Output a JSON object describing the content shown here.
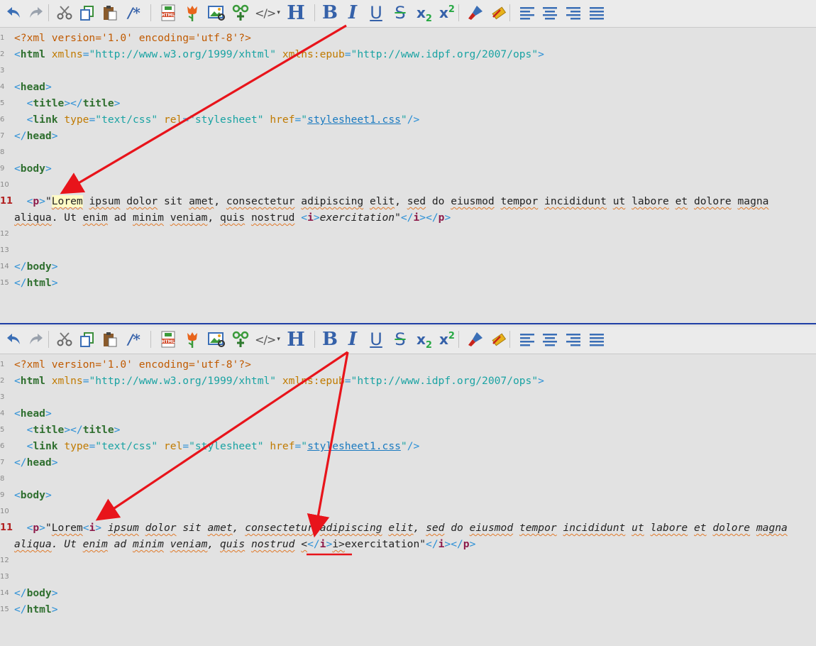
{
  "toolbar": {
    "heading_glyph": "H",
    "bold_glyph": "B",
    "italic_glyph": "I",
    "underline_glyph": "U",
    "strike_glyph": "S",
    "subscript_base": "x",
    "subscript_digit": "2",
    "superscript_base": "x",
    "superscript_digit": "2",
    "comment_glyph": "/*",
    "code_glyph": "</>",
    "dropdown_glyph": "▾",
    "icons": [
      "undo-icon",
      "redo-icon",
      "cut-icon",
      "copy-icon",
      "paste-icon",
      "comment-icon",
      "html-icon",
      "tulip-icon",
      "image-icon",
      "insert-icon",
      "code-icon",
      "heading-icon",
      "bold-icon",
      "italic-icon",
      "underline-icon",
      "strikethrough-icon",
      "subscript-icon",
      "superscript-icon",
      "brush-icon",
      "clear-format-icon",
      "align-left-icon",
      "align-center-icon",
      "align-right-icon",
      "justify-icon"
    ]
  },
  "code": {
    "xml_decl": "<?xml version='1.0' encoding='utf-8'?>",
    "html_open_tag": "html",
    "xmlns_attr": "xmlns",
    "xmlns_value": "\"http://www.w3.org/1999/xhtml\"",
    "xmlns_epub_attr": "xmlns:epub",
    "xmlns_epub_value": "\"http://www.idpf.org/2007/ops\"",
    "head_tag": "head",
    "title_tag": "title",
    "link_tag": "link",
    "type_attr": "type",
    "type_value": "\"text/css\"",
    "rel_attr": "rel",
    "rel_value": "\"stylesheet\"",
    "href_attr": "href",
    "href_value": "stylesheet1.css",
    "body_tag": "body",
    "p_tag": "p",
    "i_tag": "i",
    "lorem_word": "Lorem",
    "sentence_rest_top": [
      {
        "t": "ipsum",
        "sp": true
      },
      {
        "t": " "
      },
      {
        "t": "dolor",
        "sp": true
      },
      {
        "t": " sit "
      },
      {
        "t": "amet",
        "sp": true
      },
      {
        "t": ", "
      },
      {
        "t": "consectetur",
        "sp": true
      },
      {
        "t": " "
      },
      {
        "t": "adipiscing",
        "sp": true
      },
      {
        "t": " "
      },
      {
        "t": "elit",
        "sp": true
      },
      {
        "t": ", "
      },
      {
        "t": "sed",
        "sp": true
      },
      {
        "t": " do "
      },
      {
        "t": "eiusmod",
        "sp": true
      },
      {
        "t": " "
      },
      {
        "t": "tempor",
        "sp": true
      },
      {
        "t": " "
      },
      {
        "t": "incididunt",
        "sp": true
      },
      {
        "t": " "
      },
      {
        "t": "ut",
        "sp": true
      },
      {
        "t": " "
      },
      {
        "t": "labore",
        "sp": true
      },
      {
        "t": " "
      },
      {
        "t": "et",
        "sp": true
      },
      {
        "t": " "
      },
      {
        "t": "dolore",
        "sp": true
      },
      {
        "t": " "
      },
      {
        "t": "magna",
        "sp": true
      }
    ],
    "line2_top": [
      {
        "t": "aliqua",
        "sp": true
      },
      {
        "t": ". Ut "
      },
      {
        "t": "enim",
        "sp": true
      },
      {
        "t": " ad "
      },
      {
        "t": "minim",
        "sp": true
      },
      {
        "t": " "
      },
      {
        "t": "veniam",
        "sp": true
      },
      {
        "t": ", "
      },
      {
        "t": "quis",
        "sp": true
      },
      {
        "t": " "
      },
      {
        "t": "nostrud",
        "sp": true
      },
      {
        "t": " "
      }
    ],
    "exercitation": "exercitation",
    "broken_fragment_start": "<",
    "broken_fragment_end": "i>",
    "quote": "\""
  },
  "line_numbers": [
    "1",
    "2",
    "3",
    "4",
    "5",
    "6",
    "7",
    "8",
    "9",
    "10",
    "11",
    "12",
    "13",
    "14",
    "15"
  ],
  "colors": {
    "arrow": "#e8141b",
    "divider": "#1f3fa6",
    "background": "#e2e2e2"
  }
}
